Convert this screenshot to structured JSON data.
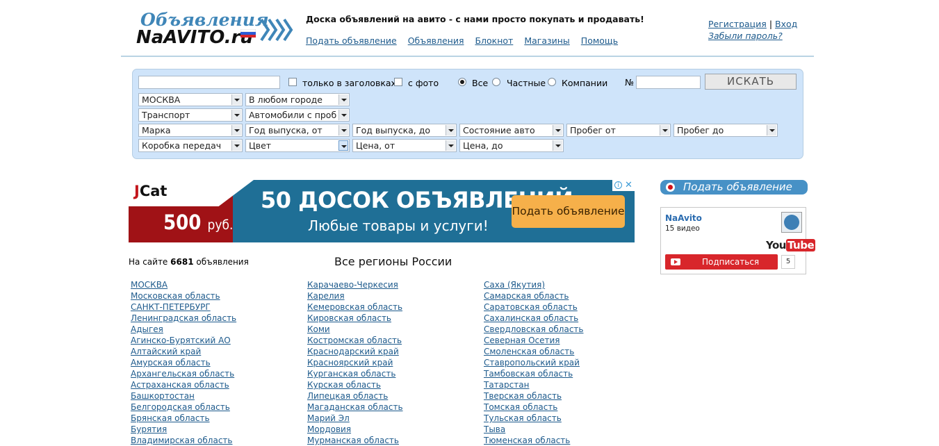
{
  "header": {
    "logo_top": "Объявления",
    "logo_bottom": "NaAVITO.ru",
    "tagline": "Доска объявлений на авито - с нами просто покупать и продавать!",
    "nav": [
      "Подать объявление",
      "Объявления",
      "Блокнот",
      "Магазины",
      "Помощь"
    ],
    "register": "Регистрация",
    "auth_sep": "|",
    "login": "Вход",
    "forgot": "Забыли пароль?"
  },
  "search": {
    "query_value": "",
    "only_titles_label": "только в заголовках",
    "with_photo_label": "с фото",
    "radio_all": "Все",
    "radio_private": "Частные",
    "radio_companies": "Компании",
    "selected_radio": "Все",
    "number_label": "№",
    "number_value": "",
    "search_button": "ИСКАТЬ",
    "city": "МОСКВА",
    "area": "В любом городе",
    "category": "Транспорт",
    "subcategory": "Автомобили с проб",
    "brand": "Марка",
    "year_from": "Год выпуска, от",
    "year_to": "Год выпуска, до",
    "condition": "Состояние авто",
    "mileage_from": "Пробег от",
    "mileage_to": "Пробег до",
    "gearbox": "Коробка передач",
    "color": "Цвет",
    "price_from": "Цена, от",
    "price_to": "Цена, до"
  },
  "banner": {
    "brand_j": "J",
    "brand_cat": "Cat",
    "price": "500",
    "price_unit": "руб.",
    "title": "50 ДОСОК ОБЪЯВЛЕНИЙ",
    "subtitle": "Любые товары и услуги!",
    "button": "Подать объявление",
    "info_icon": "i",
    "close_icon": "✕"
  },
  "sidebar": {
    "post_button": "Подать объявление",
    "youtube": {
      "channel": "NaAvito",
      "videos": "15 видео",
      "logo_you": "You",
      "logo_tube": "Tube",
      "subscribe": "Подписаться",
      "subscribers": "5"
    }
  },
  "stats": {
    "prefix": "На сайте",
    "count": "6681",
    "suffix": "объявления"
  },
  "regions": {
    "title": "Все регионы России",
    "col1": [
      "МОСКВА",
      "Московская область",
      "САНКТ-ПЕТЕРБУРГ",
      "Ленинградская область",
      "Адыгея",
      "Агинско-Бурятский АО",
      "Алтайский край",
      "Амурская область",
      "Архангельская область",
      "Астраханская область",
      "Башкортостан",
      "Белгородская область",
      "Брянская область",
      "Бурятия",
      "Владимирская область"
    ],
    "col2": [
      "Карачаево-Черкесия",
      "Карелия",
      "Кемеровская область",
      "Кировская область",
      "Коми",
      "Костромская область",
      "Краснодарский край",
      "Красноярский край",
      "Курганская область",
      "Курская область",
      "Липецкая область",
      "Магаданская область",
      "Марий Эл",
      "Мордовия",
      "Мурманская область"
    ],
    "col3": [
      "Саха (Якутия)",
      "Самарская область",
      "Саратовская область",
      "Сахалинская область",
      "Свердловская область",
      "Северная Осетия",
      "Смоленская область",
      "Ставропольский край",
      "Тамбовская область",
      "Татарстан",
      "Тверская область",
      "Томская область",
      "Тульская область",
      "Тыва",
      "Тюменская область"
    ]
  },
  "colors": {
    "link": "#1d5a8c",
    "panel_bg": "#cfe4fa",
    "banner_bg": "#1f6f96",
    "banner_red": "#a01216",
    "banner_button": "#f6b04a",
    "post_button": "#4791c6",
    "youtube_red": "#d8262b"
  }
}
